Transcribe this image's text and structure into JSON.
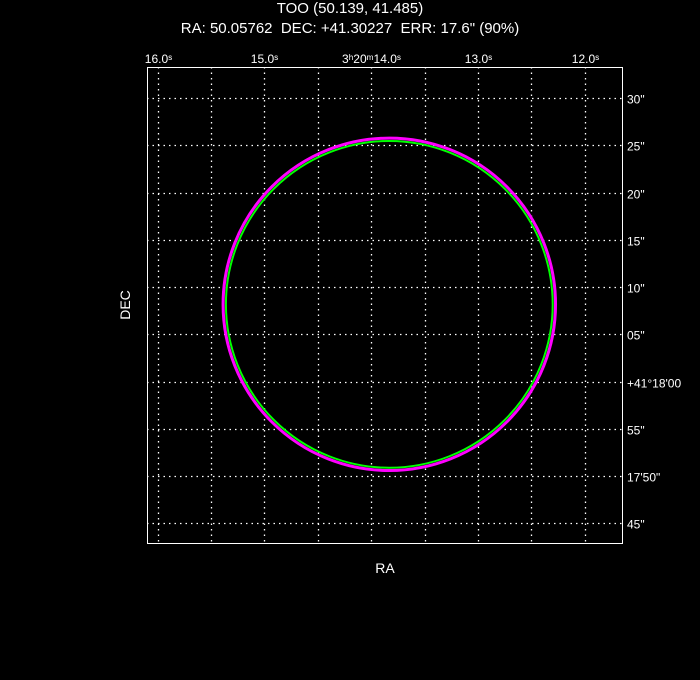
{
  "chart_data": {
    "type": "scatter",
    "title": "TOO (50.139, 41.485)",
    "subtitle": "RA: 50.05762  DEC: +41.30227  ERR: 17.6\" (90%)",
    "xlabel": "RA",
    "ylabel": "DEC",
    "grid": true,
    "x_axis": {
      "units": "RA seconds of 3h20m",
      "range": [
        16.1,
        11.65
      ],
      "ticks": [
        {
          "value": 16.0,
          "label": "16.0ˢ"
        },
        {
          "value": 15.5,
          "label": ""
        },
        {
          "value": 15.0,
          "label": "15.0ˢ"
        },
        {
          "value": 14.5,
          "label": ""
        },
        {
          "value": 14.0,
          "label": "3ʰ20ᵐ14.0ˢ"
        },
        {
          "value": 13.5,
          "label": ""
        },
        {
          "value": 13.0,
          "label": "13.0ˢ"
        },
        {
          "value": 12.5,
          "label": ""
        },
        {
          "value": 12.0,
          "label": "12.0ˢ"
        }
      ]
    },
    "y_axis": {
      "units": "DEC arcsec relative to +41°18'00\"",
      "range": [
        -17.1,
        33.3
      ],
      "ticks": [
        {
          "value": 30,
          "label": "30\""
        },
        {
          "value": 25,
          "label": "25\""
        },
        {
          "value": 20,
          "label": "20\""
        },
        {
          "value": 15,
          "label": "15\""
        },
        {
          "value": 10,
          "label": "10\""
        },
        {
          "value": 5,
          "label": "05\""
        },
        {
          "value": 0,
          "label": "+41°18'00"
        },
        {
          "value": -5,
          "label": "55\""
        },
        {
          "value": -10,
          "label": "17'50\""
        },
        {
          "value": -15,
          "label": "45\""
        }
      ]
    },
    "circles": [
      {
        "ra_sec": 13.83,
        "dec_arcsec": 8.17,
        "radius_arcsec": 17.6,
        "color": "#ff00ff"
      },
      {
        "ra_sec": 13.83,
        "dec_arcsec": 8.17,
        "radius_arcsec": 17.3,
        "color": "#00ff00"
      }
    ],
    "colors": {
      "background": "#000000",
      "axes": "#ffffff",
      "grid": "#ffffff"
    }
  }
}
